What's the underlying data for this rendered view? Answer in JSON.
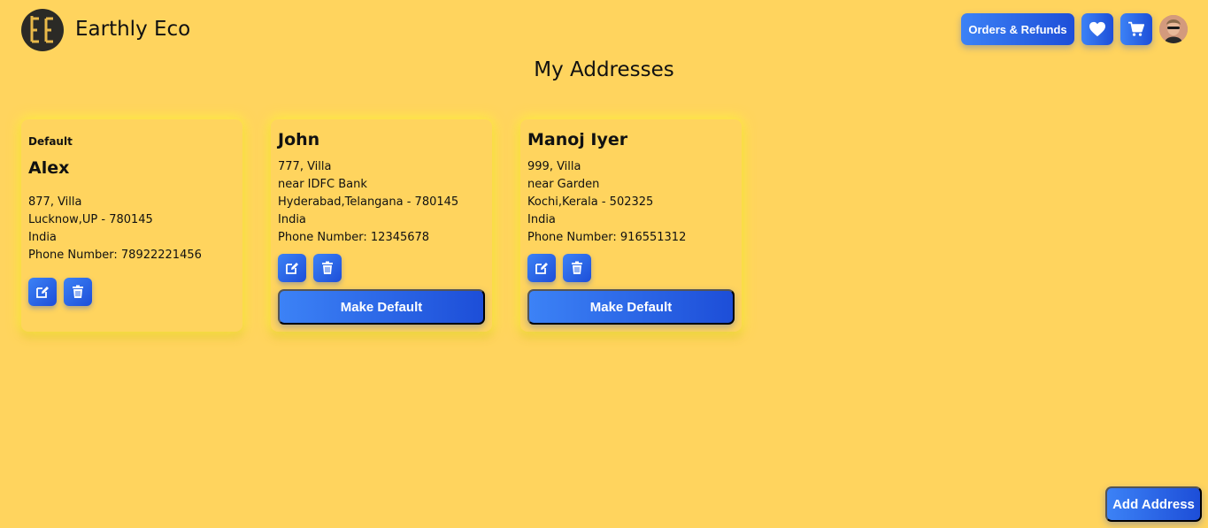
{
  "header": {
    "brand": "Earthly Eco",
    "orders_label": "Orders & Refunds",
    "wishlist_icon": "heart-icon",
    "cart_icon": "cart-icon"
  },
  "page": {
    "title": "My Addresses",
    "add_address_label": "Add Address"
  },
  "addresses": [
    {
      "tag": "Default",
      "name": "Alex",
      "lines": [
        "877, Villa",
        "Lucknow,UP - 780145",
        "India",
        "Phone Number: 78922221456"
      ]
    },
    {
      "name": "John",
      "lines": [
        "777, Villa",
        "near IDFC Bank",
        "Hyderabad,Telangana - 780145",
        "India",
        "Phone Number: 12345678"
      ],
      "make_default_label": "Make Default"
    },
    {
      "name": "Manoj Iyer",
      "lines": [
        "999, Villa",
        "near Garden",
        "Kochi,Kerala - 502325",
        "India",
        "Phone Number: 916551312"
      ],
      "make_default_label": "Make Default"
    }
  ],
  "colors": {
    "background": "#ffd45e",
    "button_start": "#3c82f6",
    "button_end": "#1d4ed8"
  }
}
